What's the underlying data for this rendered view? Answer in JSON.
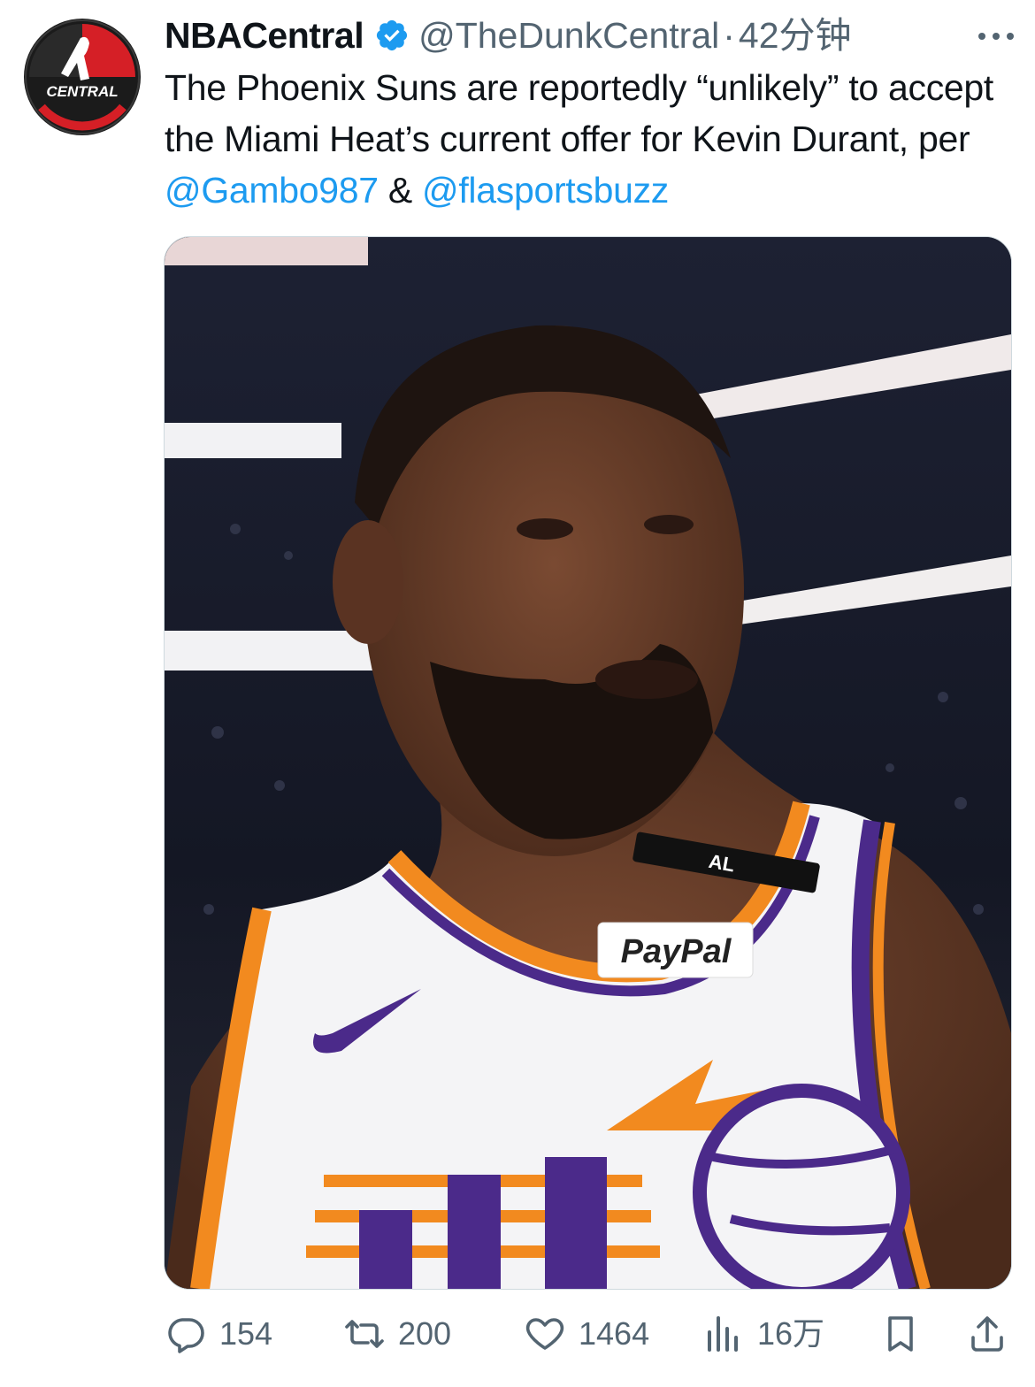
{
  "tweet": {
    "display_name": "NBACentral",
    "verified_icon": "verified-badge-icon",
    "handle": "@TheDunkCentral",
    "separator": "·",
    "time": "42分钟",
    "more_icon": "more-horizontal-icon",
    "text": {
      "part1": "The Phoenix Suns are reportedly “unlikely” to accept the Miami Heat’s current offer for Kevin Durant, per ",
      "mention1": "@Gambo987",
      "part2": " & ",
      "mention2": "@flasportsbuzz"
    },
    "avatar_text": "CENTRAL",
    "media": {
      "jersey_badge": "AL",
      "jersey_sponsor": "PayPal"
    }
  },
  "actions": {
    "reply": {
      "icon": "reply-icon",
      "count": "154"
    },
    "retweet": {
      "icon": "retweet-icon",
      "count": "200"
    },
    "like": {
      "icon": "like-icon",
      "count": "1464"
    },
    "views": {
      "icon": "views-icon",
      "count": "16万"
    },
    "bookmark": {
      "icon": "bookmark-icon"
    },
    "share": {
      "icon": "share-icon"
    }
  },
  "colors": {
    "text_primary": "#0f1419",
    "text_secondary": "#536471",
    "link": "#1d9bf0",
    "verified": "#1d9bf0",
    "suns_orange": "#f28a1f",
    "suns_purple": "#4b2a8a"
  }
}
